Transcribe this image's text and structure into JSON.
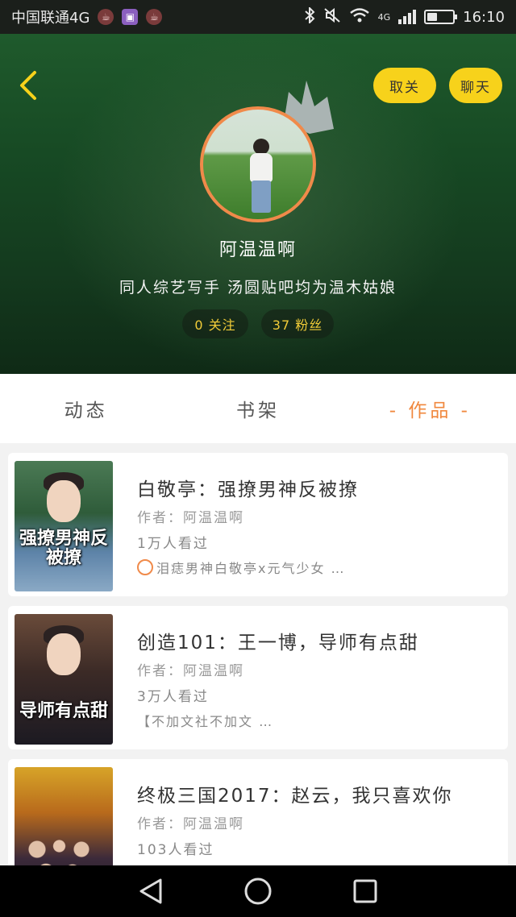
{
  "status_bar": {
    "carrier": "中国联通4G",
    "network": "4G",
    "time": "16:10",
    "battery_level": 0.4
  },
  "header": {
    "follow_label": "取关",
    "chat_label": "聊天",
    "username": "阿温温啊",
    "bio": "同人综艺写手 汤圆贴吧均为温木姑娘",
    "stats": {
      "following": "0 关注",
      "fans": "37 粉丝"
    },
    "colors": {
      "accent_yellow": "#f7d21b",
      "avatar_ring": "#f08a4a"
    }
  },
  "tabs": [
    {
      "label": "动态",
      "active": false
    },
    {
      "label": "书架",
      "active": false
    },
    {
      "label": "- 作品 -",
      "active": true
    }
  ],
  "works": [
    {
      "title": "白敬亭：强撩男神反被撩",
      "author": "作者：阿温温啊",
      "views": "1万人看过",
      "tags": "泪痣男神白敬亭x元气少女 …",
      "cover_text": "强撩男神反被撩"
    },
    {
      "title": "创造101：王一博，导师有点甜",
      "author": "作者：阿温温啊",
      "views": "3万人看过",
      "tags": "【不加文社不加文 …",
      "cover_text": "导师有点甜"
    },
    {
      "title": "终极三国2017：赵云，我只喜欢你",
      "author": "作者：阿温温啊",
      "views": "103人看过",
      "tags": "",
      "cover_text": ""
    }
  ],
  "nav": {
    "back": "back-triangle",
    "home": "home-circle",
    "recents": "recents-square"
  }
}
